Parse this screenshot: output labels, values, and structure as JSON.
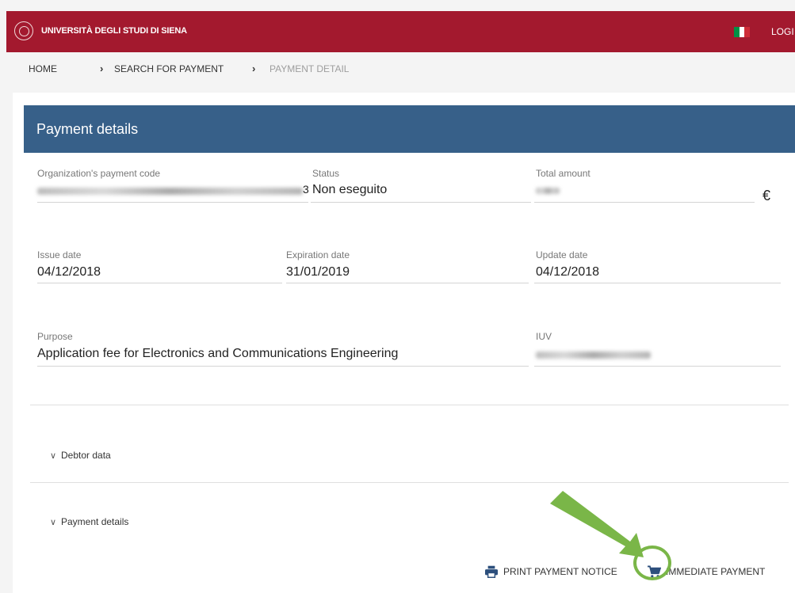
{
  "header": {
    "university_name": "UNIVERSITÀ DEGLI STUDI DI SIENA",
    "login_label": "LOGI",
    "flag_colors": [
      "#009246",
      "#ffffff",
      "#ce2b37"
    ],
    "brand_color": "#a3192e"
  },
  "breadcrumb": {
    "items": [
      "HOME",
      "SEARCH FOR PAYMENT",
      "PAYMENT DETAIL"
    ]
  },
  "card": {
    "title": "Payment details",
    "header_color": "#376089",
    "fields": {
      "org_code": {
        "label": "Organization's payment code",
        "value": "3"
      },
      "status": {
        "label": "Status",
        "value": "Non eseguito"
      },
      "total": {
        "label": "Total amount",
        "currency": "€"
      },
      "issue_date": {
        "label": "Issue date",
        "value": "04/12/2018"
      },
      "expiration_date": {
        "label": "Expiration date",
        "value": "31/01/2019"
      },
      "update_date": {
        "label": "Update date",
        "value": "04/12/2018"
      },
      "purpose": {
        "label": "Purpose",
        "value": "Application fee for Electronics and Communications Engineering"
      },
      "iuv": {
        "label": "IUV"
      }
    },
    "sections": {
      "debtor": "Debtor data",
      "payment": "Payment details"
    },
    "actions": {
      "print": "PRINT PAYMENT NOTICE",
      "pay": "IMMEDIATE PAYMENT"
    }
  },
  "annotation": {
    "highlight_color": "#7ab648"
  }
}
